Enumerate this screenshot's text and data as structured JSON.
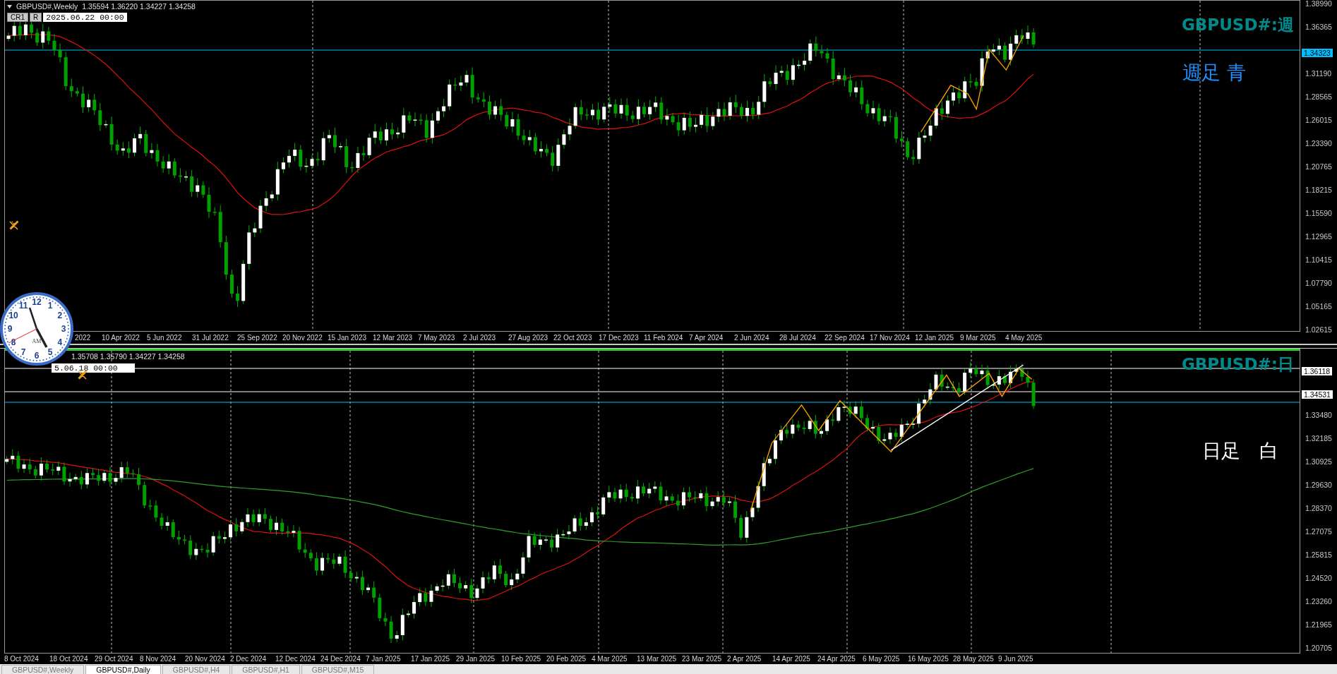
{
  "panels": [
    {
      "kind": "weekly",
      "symbol": "GBPUSD#,Weekly",
      "ohlc": "1.35594 1.36220 1.34227 1.34258",
      "buttons": [
        "CR1",
        "R"
      ],
      "date_tag": "2025.06.22 00:00",
      "title": "GBPUSD#:週",
      "note": {
        "text": "週足 青",
        "color": "#1e90ff"
      },
      "axis": [
        {
          "text": "1.38990",
          "kind": "tick"
        },
        {
          "text": "1.36365",
          "kind": "tick"
        },
        {
          "text": "1.34323",
          "kind": "tag",
          "color": "#00bfff"
        },
        {
          "text": "1.31190",
          "kind": "tick"
        },
        {
          "text": "1.28565",
          "kind": "tick"
        },
        {
          "text": "1.26015",
          "kind": "tick"
        },
        {
          "text": "1.23390",
          "kind": "tick"
        },
        {
          "text": "1.20765",
          "kind": "tick"
        },
        {
          "text": "1.18215",
          "kind": "tick"
        },
        {
          "text": "1.15590",
          "kind": "tick"
        },
        {
          "text": "1.12965",
          "kind": "tick"
        },
        {
          "text": "1.10415",
          "kind": "tick"
        },
        {
          "text": "1.07790",
          "kind": "tick"
        },
        {
          "text": "1.05165",
          "kind": "tick"
        },
        {
          "text": "1.02615",
          "kind": "tick"
        }
      ],
      "dates": [
        "2022",
        "10 Apr 2022",
        "5 Jun 2022",
        "31 Jul 2022",
        "25 Sep 2022",
        "20 Nov 2022",
        "15 Jan 2023",
        "12 Mar 2023",
        "7 May 2023",
        "2 Jul 2023",
        "27 Aug 2023",
        "22 Oct 2023",
        "17 Dec 2023",
        "11 Feb 2024",
        "7 Apr 2024",
        "2 Jun 2024",
        "28 Jul 2024",
        "22 Sep 2024",
        "17 Nov 2024",
        "12 Jan 2025",
        "9 Mar 2025",
        "4 May 2025"
      ]
    },
    {
      "kind": "daily",
      "ohlc": "1.35708 1.35790 1.34227 1.34258",
      "date_tag": "5.06.18 00:00",
      "title": "GBPUSD#:日",
      "note": {
        "text": "日足　白",
        "color": "#ffffff"
      },
      "axis": [
        {
          "text": "1.36118",
          "kind": "tag",
          "color": "#ffffff"
        },
        {
          "text": "1.34531",
          "kind": "tag",
          "color": "#ffffff"
        },
        {
          "text": "1.33480",
          "kind": "tick"
        },
        {
          "text": "1.32185",
          "kind": "tick"
        },
        {
          "text": "1.30925",
          "kind": "tick"
        },
        {
          "text": "1.29630",
          "kind": "tick"
        },
        {
          "text": "1.28370",
          "kind": "tick"
        },
        {
          "text": "1.27075",
          "kind": "tick"
        },
        {
          "text": "1.25815",
          "kind": "tick"
        },
        {
          "text": "1.24520",
          "kind": "tick"
        },
        {
          "text": "1.23260",
          "kind": "tick"
        },
        {
          "text": "1.21965",
          "kind": "tick"
        },
        {
          "text": "1.20705",
          "kind": "tick"
        }
      ],
      "dates": [
        "8 Oct 2024",
        "18 Oct 2024",
        "29 Oct 2024",
        "8 Nov 2024",
        "20 Nov 2024",
        "2 Dec 2024",
        "12 Dec 2024",
        "24 Dec 2024",
        "7 Jan 2025",
        "17 Jan 2025",
        "29 Jan 2025",
        "10 Feb 2025",
        "20 Feb 2025",
        "4 Mar 2025",
        "13 Mar 2025",
        "23 Mar 2025",
        "2 Apr 2025",
        "14 Apr 2025",
        "24 Apr 2025",
        "6 May 2025",
        "16 May 2025",
        "28 May 2025",
        "9 Jun 2025"
      ]
    }
  ],
  "clock": {
    "numbers": [
      "12",
      "11",
      "1",
      "10",
      "2",
      "9",
      "3",
      "8",
      "4",
      "7",
      "5",
      "6"
    ],
    "period": "AM"
  },
  "tabs": [
    {
      "label": "GBPUSD#,Weekly",
      "selected": false
    },
    {
      "label": "GBPUSD#,Daily",
      "selected": true
    },
    {
      "label": "GBPUSD#,H4",
      "selected": false
    },
    {
      "label": "GBPUSD#,H1",
      "selected": false
    },
    {
      "label": "GBPUSD#,M15",
      "selected": false
    }
  ]
}
